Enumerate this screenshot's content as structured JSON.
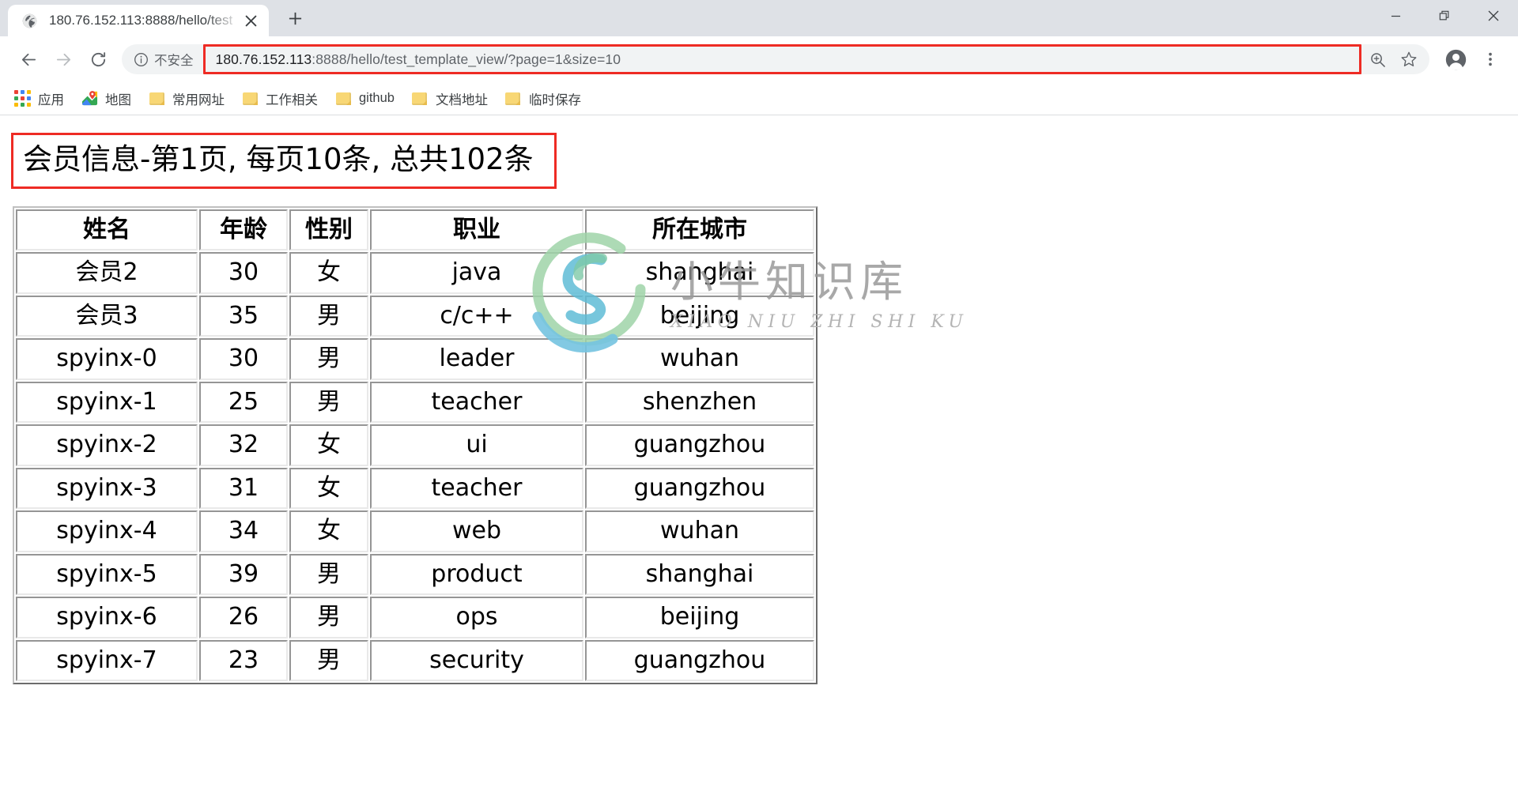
{
  "window": {
    "controls": [
      {
        "name": "minimize",
        "glyph": "—"
      },
      {
        "name": "restore",
        "glyph": "❐"
      },
      {
        "name": "close",
        "glyph": "✕"
      }
    ]
  },
  "tab": {
    "title": "180.76.152.113:8888/hello/test",
    "favicon": "globe-icon",
    "close_glyph": "✕",
    "new_tab_glyph": "+"
  },
  "toolbar": {
    "back_glyph": "←",
    "forward_glyph": "→",
    "reload_glyph": "↻",
    "security_label": "不安全",
    "security_icon": "info-circle-icon",
    "url_host": "180.76.152.113",
    "url_rest": ":8888/hello/test_template_view/?page=1&size=10",
    "url_full": "180.76.152.113:8888/hello/test_template_view/?page=1&size=10",
    "zoom_icon": "zoom-in-icon",
    "bookmark_icon": "star-icon",
    "profile_icon": "account-avatar-icon",
    "menu_icon": "three-dot-menu-icon",
    "highlight_color": "#ee2b24"
  },
  "bookmarks": [
    {
      "label": "应用",
      "icon": "apps-grid-icon"
    },
    {
      "label": "地图",
      "icon": "maps-pin-icon"
    },
    {
      "label": "常用网址",
      "icon": "folder-icon"
    },
    {
      "label": "工作相关",
      "icon": "folder-icon"
    },
    {
      "label": "github",
      "icon": "folder-icon"
    },
    {
      "label": "文档地址",
      "icon": "folder-icon"
    },
    {
      "label": "临时保存",
      "icon": "folder-icon"
    }
  ],
  "page": {
    "title": "会员信息-第1页, 每页10条, 总共102条",
    "title_border_color": "#ee2b24",
    "table": {
      "headers": [
        "姓名",
        "年龄",
        "性别",
        "职业",
        "所在城市"
      ],
      "rows": [
        {
          "name": "会员2",
          "age": "30",
          "sex": "女",
          "job": "java",
          "city": "shanghai"
        },
        {
          "name": "会员3",
          "age": "35",
          "sex": "男",
          "job": "c/c++",
          "city": "beijing"
        },
        {
          "name": "spyinx-0",
          "age": "30",
          "sex": "男",
          "job": "leader",
          "city": "wuhan"
        },
        {
          "name": "spyinx-1",
          "age": "25",
          "sex": "男",
          "job": "teacher",
          "city": "shenzhen"
        },
        {
          "name": "spyinx-2",
          "age": "32",
          "sex": "女",
          "job": "ui",
          "city": "guangzhou"
        },
        {
          "name": "spyinx-3",
          "age": "31",
          "sex": "女",
          "job": "teacher",
          "city": "guangzhou"
        },
        {
          "name": "spyinx-4",
          "age": "34",
          "sex": "女",
          "job": "web",
          "city": "wuhan"
        },
        {
          "name": "spyinx-5",
          "age": "39",
          "sex": "男",
          "job": "product",
          "city": "shanghai"
        },
        {
          "name": "spyinx-6",
          "age": "26",
          "sex": "男",
          "job": "ops",
          "city": "beijing"
        },
        {
          "name": "spyinx-7",
          "age": "23",
          "sex": "男",
          "job": "security",
          "city": "guangzhou"
        }
      ]
    },
    "watermark": {
      "cn": "小牛知识库",
      "en": "XIAO NIU ZHI SHI KU"
    }
  }
}
